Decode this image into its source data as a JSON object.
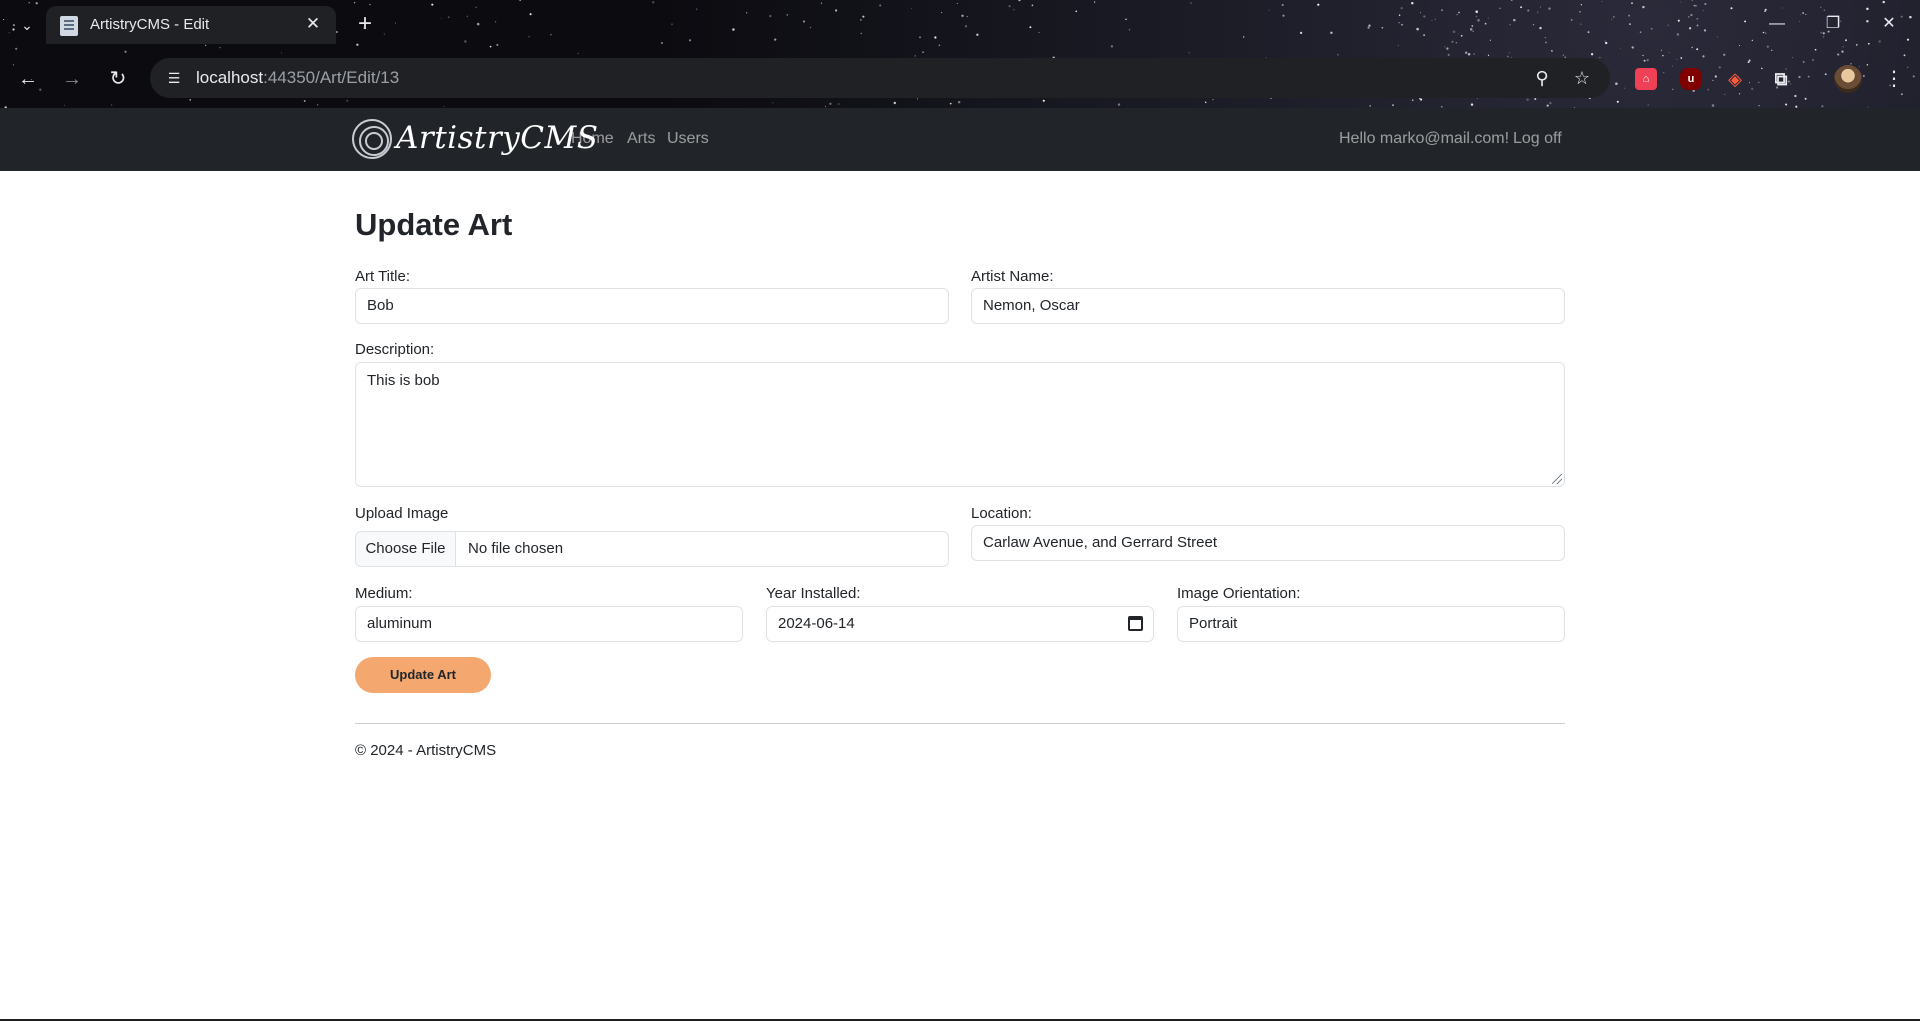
{
  "browser": {
    "tab_title": "ArtistryCMS - Edit",
    "tab_close": "✕",
    "new_tab": "+",
    "url_host": "localhost",
    "url_path": ":44350/Art/Edit/13",
    "extensions": [
      "pocket-extension",
      "ublock-origin-extension",
      "scholar-extension",
      "puzzle-extensions-icon"
    ],
    "profile": "avatar"
  },
  "navbar": {
    "brand": "ArtistryCMS",
    "links": [
      "Home",
      "Arts",
      "Users"
    ],
    "greeting": "Hello marko@mail.com!",
    "logoff": "Log off"
  },
  "form": {
    "heading": "Update Art",
    "art_title_label": "Art Title:",
    "art_title_value": "Bob",
    "artist_name_label": "Artist Name:",
    "artist_name_value": "Nemon, Oscar",
    "description_label": "Description:",
    "description_value": "This is bob",
    "upload_label": "Upload Image",
    "choose_file": "Choose File",
    "no_file": "No file chosen",
    "location_label": "Location:",
    "location_value": "Carlaw Avenue, and Gerrard Street",
    "medium_label": "Medium:",
    "medium_value": "aluminum",
    "year_label": "Year Installed:",
    "year_value": "2024-06-14",
    "orientation_label": "Image Orientation:",
    "orientation_value": "Portrait",
    "submit": "Update Art"
  },
  "footer": {
    "text": "© 2024 - ArtistryCMS"
  },
  "colors": {
    "navbar_bg": "#212529",
    "submit_bg": "#f4a870",
    "tab_bg": "#202124"
  }
}
